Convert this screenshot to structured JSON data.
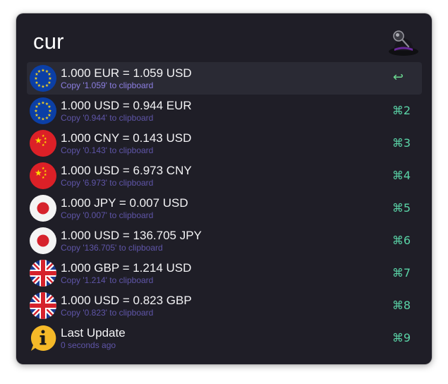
{
  "search": {
    "query": "cur"
  },
  "results": [
    {
      "title": "1.000 EUR = 1.059 USD",
      "subtitle": "Copy '1.059' to clipboard",
      "shortcut": "↩",
      "icon": "eu-flag-icon",
      "selected": true
    },
    {
      "title": "1.000 USD = 0.944 EUR",
      "subtitle": "Copy '0.944' to clipboard",
      "shortcut": "⌘2",
      "icon": "eu-flag-icon"
    },
    {
      "title": "1.000 CNY = 0.143 USD",
      "subtitle": "Copy '0.143' to clipboard",
      "shortcut": "⌘3",
      "icon": "china-flag-icon"
    },
    {
      "title": "1.000 USD = 6.973 CNY",
      "subtitle": "Copy '6.973' to clipboard",
      "shortcut": "⌘4",
      "icon": "china-flag-icon"
    },
    {
      "title": "1.000 JPY = 0.007 USD",
      "subtitle": "Copy '0.007' to clipboard",
      "shortcut": "⌘5",
      "icon": "japan-flag-icon"
    },
    {
      "title": "1.000 USD = 136.705 JPY",
      "subtitle": "Copy '136.705' to clipboard",
      "shortcut": "⌘6",
      "icon": "japan-flag-icon"
    },
    {
      "title": "1.000 GBP = 1.214 USD",
      "subtitle": "Copy '1.214' to clipboard",
      "shortcut": "⌘7",
      "icon": "uk-flag-icon"
    },
    {
      "title": "1.000 USD = 0.823 GBP",
      "subtitle": "Copy '0.823' to clipboard",
      "shortcut": "⌘8",
      "icon": "uk-flag-icon"
    },
    {
      "title": "Last Update",
      "subtitle": "0 seconds ago",
      "shortcut": "⌘9",
      "icon": "info-bubble-icon"
    }
  ],
  "colors": {
    "window_bg": "#1f1e27",
    "selected_row_bg": "#2a2a34",
    "subtitle": "#5f55a8",
    "shortcut": "#5ad4a7",
    "eu_blue": "#0b3fa6",
    "china_red": "#dc2027",
    "japan_red": "#d6222c",
    "uk_blue": "#1a3a8f",
    "info_yellow": "#f5b928"
  }
}
